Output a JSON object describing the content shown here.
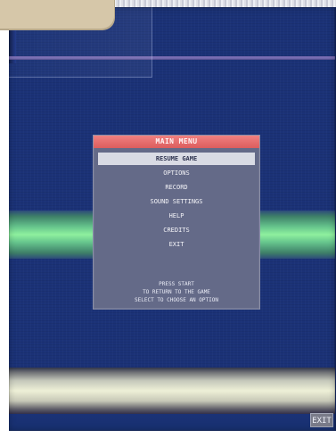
{
  "menu": {
    "header": "MAIN MENU",
    "items": [
      {
        "label": "RESUME GAME"
      },
      {
        "label": "OPTIONS"
      },
      {
        "label": "RECORD"
      },
      {
        "label": "SOUND SETTINGS"
      },
      {
        "label": "HELP"
      },
      {
        "label": "CREDITS"
      },
      {
        "label": "EXIT"
      }
    ],
    "footer": [
      "PRESS START",
      "TO RETURN TO THE GAME",
      "SELECT TO CHOOSE AN OPTION"
    ]
  },
  "corner_button": {
    "label": "EXIT"
  },
  "colors": {
    "screen_bg": "#1b3277",
    "menu_bg": "#646a88",
    "menu_header": "#e56a6a",
    "green_band": "#8ef09e",
    "cream_band": "#eef0d7",
    "tan_tab": "#d6c7a9"
  }
}
